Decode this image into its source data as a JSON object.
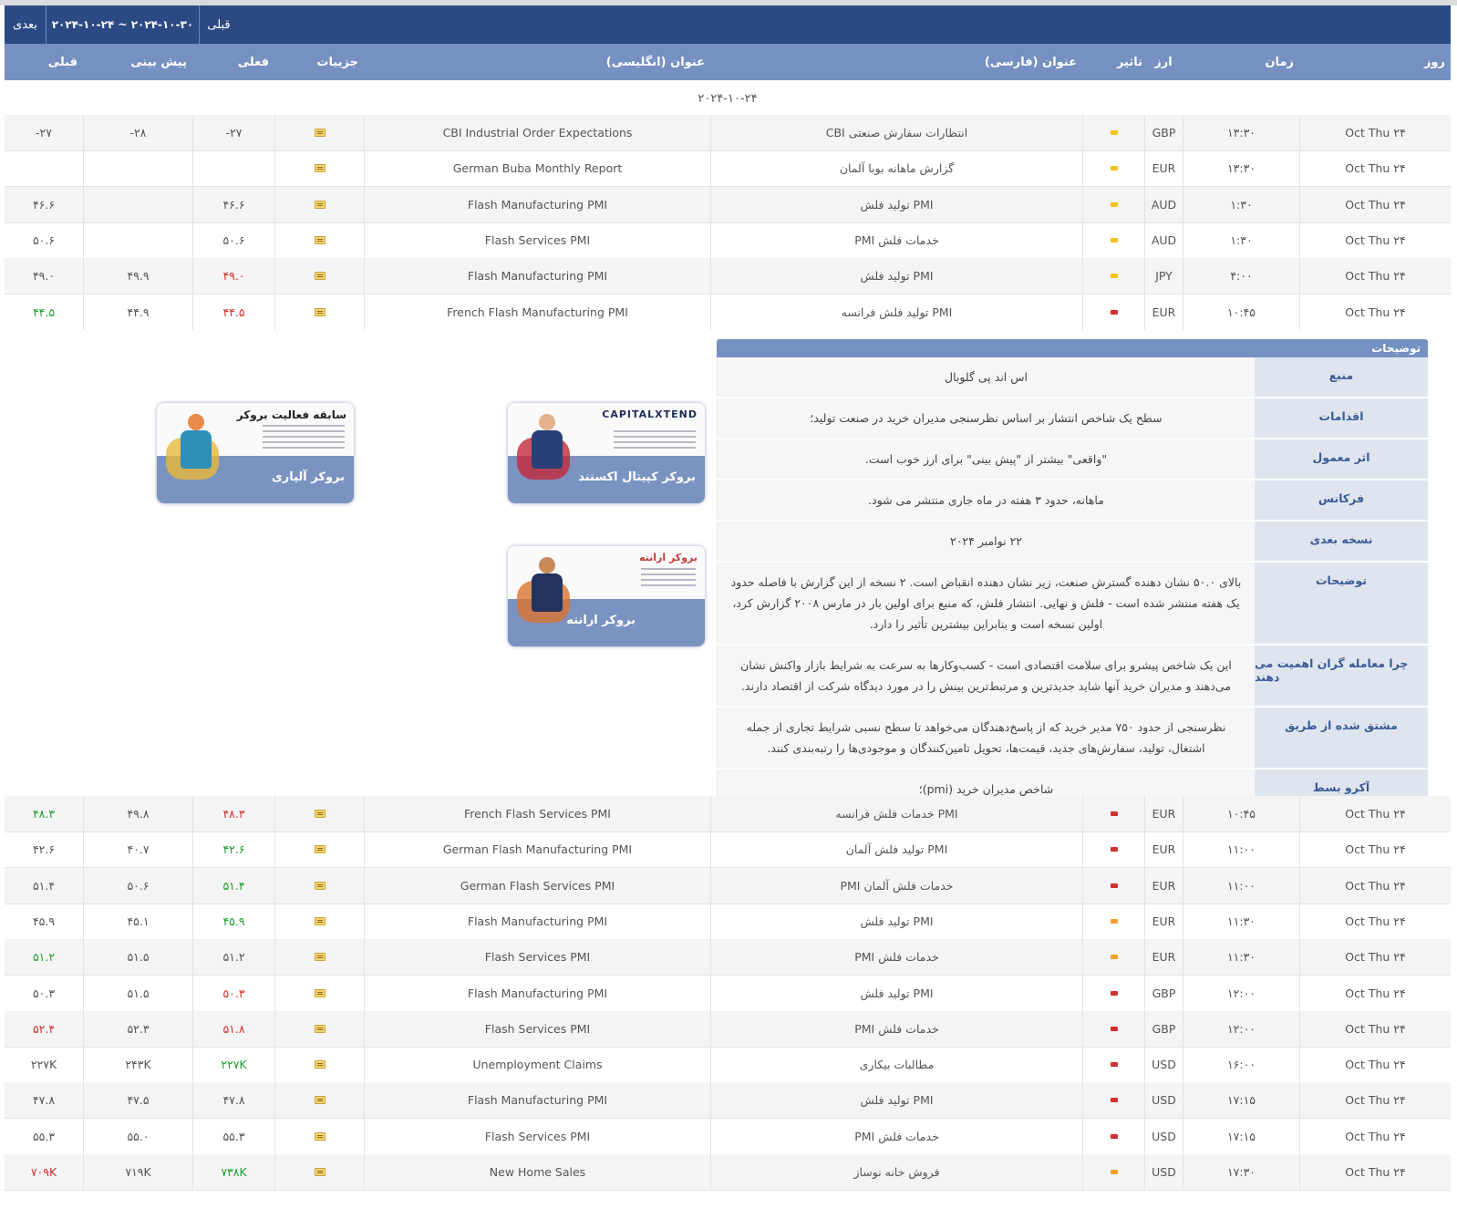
{
  "nav": {
    "next_label": "بعدی",
    "range": "۲۰۲۴-۱۰-۲۴ ~ ۲۰۲۴-۱۰-۳۰",
    "prev_label": "قبلی"
  },
  "columns": {
    "day": "روز",
    "time": "زمان",
    "currency": "ارز",
    "impact": "تاثیر",
    "title_fa": "عنوان (فارسی)",
    "title_en": "عنوان (انگلیسی)",
    "details": "جزییات",
    "actual": "فعلی",
    "forecast": "پیش بینی",
    "previous": "قبلی"
  },
  "date_label": "۲۰۲۴-۱۰-۲۴",
  "colors": {
    "header_dark": "#2b4a84",
    "header_light": "#7590c1",
    "impact_high": "#d22f2f",
    "impact_medium": "#f0a030",
    "impact_low": "#f2c318",
    "better": "#1f9d2f",
    "worse": "#d22f2f"
  },
  "events_top": [
    {
      "day": "Oct Thu ۲۴",
      "time": "۱۳:۳۰",
      "currency": "GBP",
      "impact": "low",
      "title_fa": "انتظارات سفارش صنعتی CBI",
      "title_en": "CBI Industrial Order Expectations",
      "actual": "-۲۷",
      "actual_color": "",
      "forecast": "-۲۸",
      "previous": "-۲۷",
      "previous_color": ""
    },
    {
      "day": "Oct Thu ۲۴",
      "time": "۱۳:۳۰",
      "currency": "EUR",
      "impact": "low",
      "title_fa": "گزارش ماهانه بوبا آلمان",
      "title_en": "German Buba Monthly Report",
      "actual": "",
      "actual_color": "",
      "forecast": "",
      "previous": "",
      "previous_color": ""
    },
    {
      "day": "Oct Thu ۲۴",
      "time": "۱:۳۰",
      "currency": "AUD",
      "impact": "low",
      "title_fa": "PMI تولید فلش",
      "title_en": "Flash Manufacturing PMI",
      "actual": "۴۶.۶",
      "actual_color": "",
      "forecast": "",
      "previous": "۴۶.۶",
      "previous_color": ""
    },
    {
      "day": "Oct Thu ۲۴",
      "time": "۱:۳۰",
      "currency": "AUD",
      "impact": "low",
      "title_fa": "خدمات فلش PMI",
      "title_en": "Flash Services PMI",
      "actual": "۵۰.۶",
      "actual_color": "",
      "forecast": "",
      "previous": "۵۰.۶",
      "previous_color": ""
    },
    {
      "day": "Oct Thu ۲۴",
      "time": "۴:۰۰",
      "currency": "JPY",
      "impact": "low",
      "title_fa": "PMI تولید فلش",
      "title_en": "Flash Manufacturing PMI",
      "actual": "۴۹.۰",
      "actual_color": "red",
      "forecast": "۴۹.۹",
      "previous": "۴۹.۰",
      "previous_color": ""
    },
    {
      "day": "Oct Thu ۲۴",
      "time": "۱۰:۴۵",
      "currency": "EUR",
      "impact": "high",
      "title_fa": "PMI تولید فلش فرانسه",
      "title_en": "French Flash Manufacturing PMI",
      "actual": "۴۴.۵",
      "actual_color": "red",
      "forecast": "۴۴.۹",
      "previous": "۴۴.۵",
      "previous_color": "green"
    }
  ],
  "description": {
    "title": "توضیحات",
    "rows": [
      {
        "label": "منبع",
        "value": "اس اند پی گلوبال"
      },
      {
        "label": "اقدامات",
        "value": "سطح یک شاخص انتشار بر اساس نظرسنجی مدیران خرید در صنعت تولید؛"
      },
      {
        "label": "اثر معمول",
        "value": "\"واقعی\" بیشتر از \"پیش بینی\" برای ارز خوب است."
      },
      {
        "label": "فرکانس",
        "value": "ماهانه، حدود ۳ هفته در ماه جاری منتشر می شود."
      },
      {
        "label": "نسخه بعدی",
        "value": "۲۲ نوامبر ۲۰۲۴"
      },
      {
        "label": "توضیحات",
        "value": "بالای ۵۰.۰ نشان دهنده گسترش صنعت، زیر نشان دهنده انقباض است. ۲ نسخه از این گزارش با فاصله حدود یک هفته منتشر شده است - فلش و نهایی. انتشار فلش، که منبع برای اولین بار در مارس ۲۰۰۸ گزارش کرد، اولین نسخه است و بنابراین بیشترین تأثیر را دارد."
      },
      {
        "label": "چرا معامله گران اهمیت می دهند",
        "value": "این یک شاخص پیشرو برای سلامت اقتصادی است - کسب‌وکارها به سرعت به شرایط بازار واکنش نشان می‌دهند و مدیران خرید آنها شاید جدیدترین و مرتبط‌ترین بینش را در مورد دیدگاه شرکت از اقتصاد دارند."
      },
      {
        "label": "مشتق شده از طریق",
        "value": "نظرسنجی از حدود ۷۵۰ مدیر خرید که از پاسخ‌دهندگان می‌خواهد تا سطح نسبی شرایط تجاری از جمله اشتغال، تولید، سفارش‌های جدید، قیمت‌ها، تحویل تامین‌کنندگان و موجودی‌ها را رتبه‌بندی کنند."
      },
      {
        "label": "آکرو بسط",
        "value": "شاخص مدیران خرید (pmi)؛"
      }
    ]
  },
  "ads": [
    {
      "title": "بروکر کپیتال اکستند",
      "brand": "CAPITALXTEND"
    },
    {
      "title": "بروکر آلپاری",
      "brand": "سابقه فعالیت بروکر"
    },
    {
      "title": "بروکر ارانته",
      "brand": "بروکر ارانته"
    }
  ],
  "events_bottom": [
    {
      "day": "Oct Thu ۲۴",
      "time": "۱۰:۴۵",
      "currency": "EUR",
      "impact": "high",
      "title_fa": "PMI خدمات فلش فرانسه",
      "title_en": "French Flash Services PMI",
      "actual": "۴۸.۳",
      "actual_color": "red",
      "forecast": "۴۹.۸",
      "previous": "۴۸.۳",
      "previous_color": "green"
    },
    {
      "day": "Oct Thu ۲۴",
      "time": "۱۱:۰۰",
      "currency": "EUR",
      "impact": "high",
      "title_fa": "PMI تولید فلش آلمان",
      "title_en": "German Flash Manufacturing PMI",
      "actual": "۴۲.۶",
      "actual_color": "green",
      "forecast": "۴۰.۷",
      "previous": "۴۲.۶",
      "previous_color": ""
    },
    {
      "day": "Oct Thu ۲۴",
      "time": "۱۱:۰۰",
      "currency": "EUR",
      "impact": "high",
      "title_fa": "خدمات فلش آلمان PMI",
      "title_en": "German Flash Services PMI",
      "actual": "۵۱.۴",
      "actual_color": "green",
      "forecast": "۵۰.۶",
      "previous": "۵۱.۴",
      "previous_color": ""
    },
    {
      "day": "Oct Thu ۲۴",
      "time": "۱۱:۳۰",
      "currency": "EUR",
      "impact": "medium",
      "title_fa": "PMI تولید فلش",
      "title_en": "Flash Manufacturing PMI",
      "actual": "۴۵.۹",
      "actual_color": "green",
      "forecast": "۴۵.۱",
      "previous": "۴۵.۹",
      "previous_color": ""
    },
    {
      "day": "Oct Thu ۲۴",
      "time": "۱۱:۳۰",
      "currency": "EUR",
      "impact": "medium",
      "title_fa": "خدمات فلش PMI",
      "title_en": "Flash Services PMI",
      "actual": "۵۱.۲",
      "actual_color": "",
      "forecast": "۵۱.۵",
      "previous": "۵۱.۲",
      "previous_color": "green"
    },
    {
      "day": "Oct Thu ۲۴",
      "time": "۱۲:۰۰",
      "currency": "GBP",
      "impact": "high",
      "title_fa": "PMI تولید فلش",
      "title_en": "Flash Manufacturing PMI",
      "actual": "۵۰.۳",
      "actual_color": "red",
      "forecast": "۵۱.۵",
      "previous": "۵۰.۳",
      "previous_color": ""
    },
    {
      "day": "Oct Thu ۲۴",
      "time": "۱۲:۰۰",
      "currency": "GBP",
      "impact": "high",
      "title_fa": "خدمات فلش PMI",
      "title_en": "Flash Services PMI",
      "actual": "۵۱.۸",
      "actual_color": "red",
      "forecast": "۵۲.۳",
      "previous": "۵۲.۴",
      "previous_color": "red"
    },
    {
      "day": "Oct Thu ۲۴",
      "time": "۱۶:۰۰",
      "currency": "USD",
      "impact": "high",
      "title_fa": "مطالبات بیکاری",
      "title_en": "Unemployment Claims",
      "actual": "۲۲۷K",
      "actual_color": "green",
      "forecast": "۲۴۳K",
      "previous": "۲۲۷K",
      "previous_color": ""
    },
    {
      "day": "Oct Thu ۲۴",
      "time": "۱۷:۱۵",
      "currency": "USD",
      "impact": "high",
      "title_fa": "PMI تولید فلش",
      "title_en": "Flash Manufacturing PMI",
      "actual": "۴۷.۸",
      "actual_color": "",
      "forecast": "۴۷.۵",
      "previous": "۴۷.۸",
      "previous_color": ""
    },
    {
      "day": "Oct Thu ۲۴",
      "time": "۱۷:۱۵",
      "currency": "USD",
      "impact": "high",
      "title_fa": "خدمات فلش PMI",
      "title_en": "Flash Services PMI",
      "actual": "۵۵.۳",
      "actual_color": "",
      "forecast": "۵۵.۰",
      "previous": "۵۵.۳",
      "previous_color": ""
    },
    {
      "day": "Oct Thu ۲۴",
      "time": "۱۷:۳۰",
      "currency": "USD",
      "impact": "medium",
      "title_fa": "فروش خانه نوساز",
      "title_en": "New Home Sales",
      "actual": "۷۳۸K",
      "actual_color": "green",
      "forecast": "۷۱۹K",
      "previous": "۷۰۹K",
      "previous_color": "red"
    }
  ]
}
